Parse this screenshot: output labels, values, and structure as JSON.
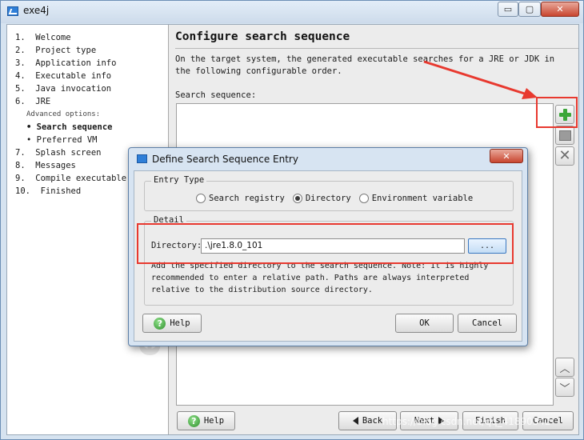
{
  "window": {
    "title": "exe4j",
    "minimize_glyph": "▭",
    "maximize_glyph": "▢",
    "close_glyph": "✕"
  },
  "steps": [
    {
      "label": "1.  Welcome",
      "kind": "step"
    },
    {
      "label": "2.  Project type",
      "kind": "step"
    },
    {
      "label": "3.  Application info",
      "kind": "step"
    },
    {
      "label": "4.  Executable info",
      "kind": "step"
    },
    {
      "label": "5.  Java invocation",
      "kind": "step"
    },
    {
      "label": "6.  JRE",
      "kind": "step"
    },
    {
      "label": "Advanced options:",
      "kind": "sub"
    },
    {
      "label": "• Search sequence",
      "kind": "active"
    },
    {
      "label": "• Preferred VM",
      "kind": "bullet"
    },
    {
      "label": "7.  Splash screen",
      "kind": "step"
    },
    {
      "label": "8.  Messages",
      "kind": "step"
    },
    {
      "label": "9.  Compile executable",
      "kind": "step"
    },
    {
      "label": "10.  Finished",
      "kind": "step"
    }
  ],
  "sidebar_watermark": "exe4j",
  "main": {
    "title": "Configure search sequence",
    "description": "On the target system, the generated executable searches for a JRE or JDK in the following configurable order.",
    "list_label": "Search sequence:"
  },
  "side_buttons": {
    "add_icon": "plus-icon",
    "edit_icon": "edit-icon",
    "delete_icon": "delete-icon",
    "up_glyph": "︿",
    "down_glyph": "﹀"
  },
  "bottom": {
    "help": "Help",
    "back": "Back",
    "next": "Next",
    "finish": "Finish",
    "cancel": "Cancel",
    "help_glyph": "?"
  },
  "dialog": {
    "title": "Define Search Sequence Entry",
    "close_glyph": "✕",
    "entry_type": {
      "legend": "Entry Type",
      "options": [
        "Search registry",
        "Directory",
        "Environment variable"
      ],
      "selected": "Directory"
    },
    "detail": {
      "legend": "Detail",
      "directory_label": "Directory:",
      "directory_value": ".\\jre1.8.0_101",
      "browse_label": "...",
      "note": "Add the specified directory to the search sequence. Note: It is highly recommended to enter a relative path. Paths are always interpreted relative to the distribution source directory."
    },
    "help": "Help",
    "ok": "OK",
    "cancel": "Cancel"
  },
  "annotation_color": "#e8392f",
  "watermark": "https://blog.csdn.net/qq_41890342"
}
